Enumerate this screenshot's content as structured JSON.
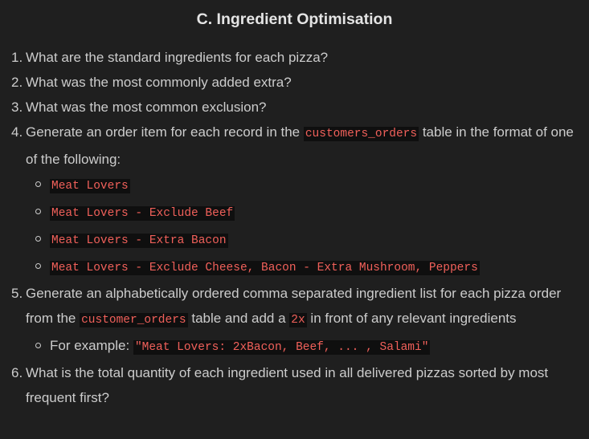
{
  "heading": "C. Ingredient Optimisation",
  "questions": {
    "q1": "What are the standard ingredients for each pizza?",
    "q2": "What was the most commonly added extra?",
    "q3": "What was the most common exclusion?",
    "q4": {
      "pre": "Generate an order item for each record in the ",
      "code": "customers_orders",
      "post": " table in the format of one of the following:",
      "examples": [
        "Meat Lovers",
        "Meat Lovers - Exclude Beef",
        "Meat Lovers - Extra Bacon",
        "Meat Lovers - Exclude Cheese, Bacon - Extra Mushroom, Peppers"
      ]
    },
    "q5": {
      "pre": "Generate an alphabetically ordered comma separated ingredient list for each pizza order from the ",
      "code1": "customer_orders",
      "mid": " table and add a ",
      "code2": "2x",
      "post": " in front of any relevant ingredients",
      "example_label": "For example: ",
      "example_code": "\"Meat Lovers: 2xBacon, Beef, ... , Salami\""
    },
    "q6": "What is the total quantity of each ingredient used in all delivered pizzas sorted by most frequent first?"
  }
}
